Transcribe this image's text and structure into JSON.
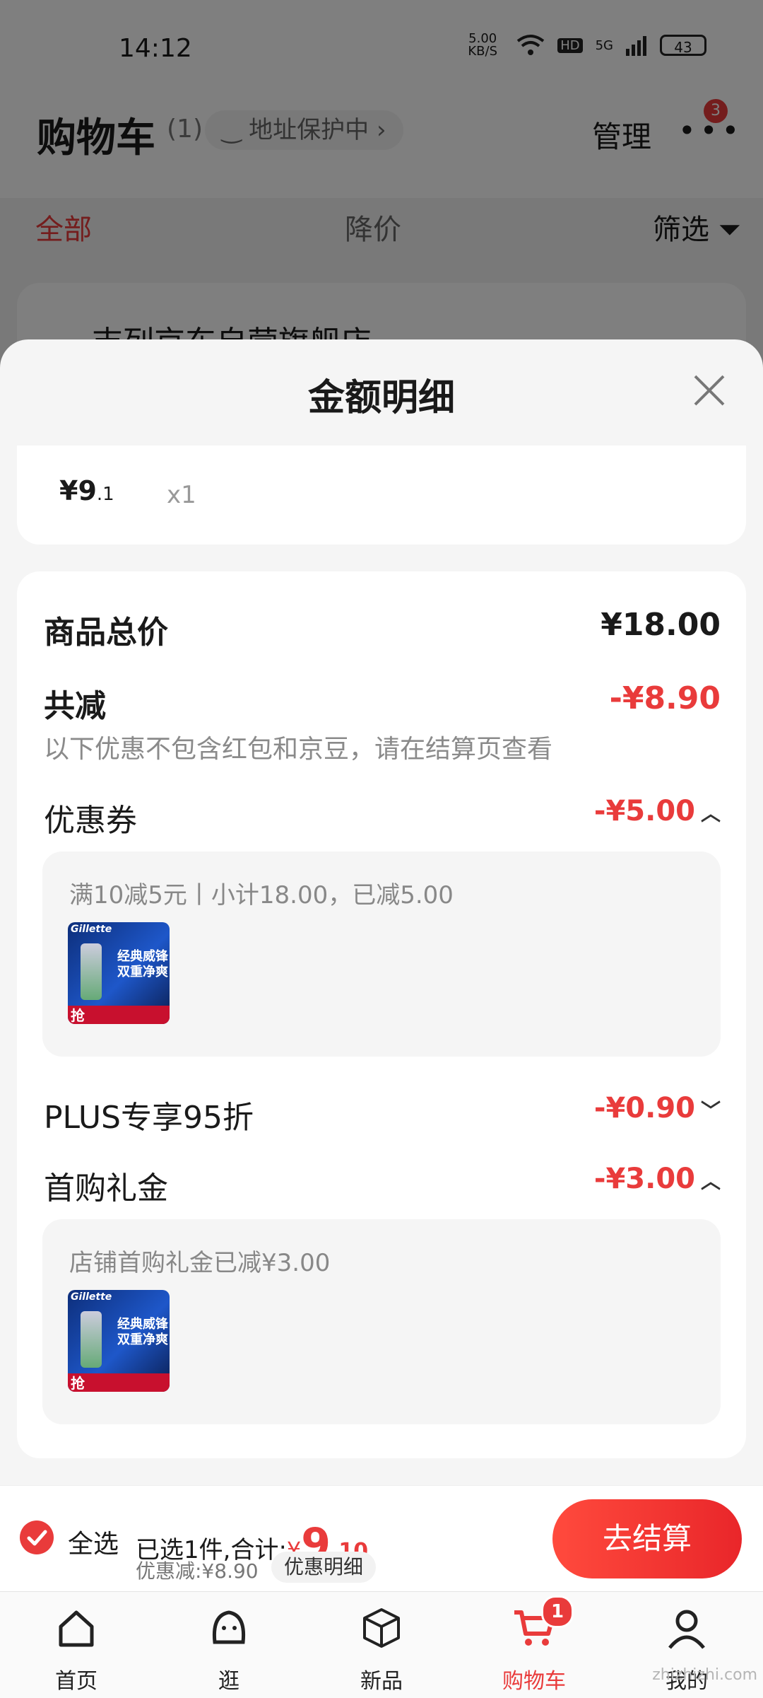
{
  "status_bar": {
    "time": "14:12",
    "net_speed": "5.00 KB/S",
    "hd": "HD",
    "signal": "5G",
    "battery": "43"
  },
  "header": {
    "title": "购物车",
    "count": "(1)",
    "address_protect": "地址保护中",
    "manage": "管理",
    "more_badge": "3"
  },
  "filters": {
    "all": "全部",
    "price_drop": "降价",
    "filter": "筛选"
  },
  "store": {
    "name": "吉列京东自营旗舰店"
  },
  "sheet": {
    "title": "金额明细",
    "item_price_main": "¥9",
    "item_price_dec": ".1",
    "item_qty": "x1",
    "goods_total_label": "商品总价",
    "goods_total_value": "¥18.00",
    "reduce_label": "共减",
    "reduce_value": "-¥8.90",
    "reduce_note": "以下优惠不包含红包和京豆，请在结算页查看",
    "coupon_label": "优惠券",
    "coupon_value": "-¥5.00",
    "coupon_detail": "满10减5元丨小计18.00，已减5.00",
    "plus_label": "PLUS专享95折",
    "plus_value": "-¥0.90",
    "gift_label": "首购礼金",
    "gift_value": "-¥3.00",
    "gift_detail": "店铺首购礼金已减¥3.00",
    "product_brand": "Gillette",
    "product_slogan_1": "经典威锋",
    "product_slogan_2": "双重净爽",
    "product_tag": "抢"
  },
  "bottom": {
    "select_all": "全选",
    "selected_text": "已选1件,合计:",
    "currency": "¥",
    "total_int": "9",
    "total_dec": ".10",
    "discount_text": "优惠减:¥8.90",
    "detail_button": "优惠明细",
    "checkout": "去结算"
  },
  "tabbar": {
    "home": "首页",
    "browse": "逛",
    "new": "新品",
    "cart": "购物车",
    "cart_badge": "1",
    "mine": "我的"
  },
  "watermark": "zhizhizhi.com",
  "colors": {
    "accent": "#e93b3b"
  }
}
